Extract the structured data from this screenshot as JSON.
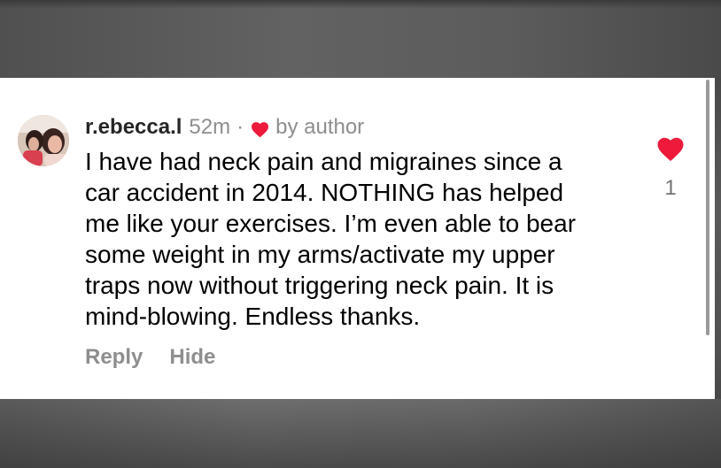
{
  "comment": {
    "username": "r.ebecca.l",
    "time_ago": "52m",
    "separator": "·",
    "liked_by": "by author",
    "text": "I have had neck pain and migraines since a\ncar accident in 2014. NOTHING has helped\nme like your exercises. I’m even able to bear\nsome weight in my arms/activate my upper\ntraps now without triggering neck pain. It is\nmind-blowing. Endless thanks.",
    "like_count": "1",
    "actions": {
      "reply_label": "Reply",
      "hide_label": "Hide"
    },
    "avatar_icon": "profile-photo",
    "author_like_icon": "heart-icon",
    "like_icon": "heart-icon"
  },
  "colors": {
    "heart": "#ed1a3b",
    "secondary_text": "#8e8e8e",
    "primary_text": "#000000",
    "card_background": "#ffffff"
  }
}
